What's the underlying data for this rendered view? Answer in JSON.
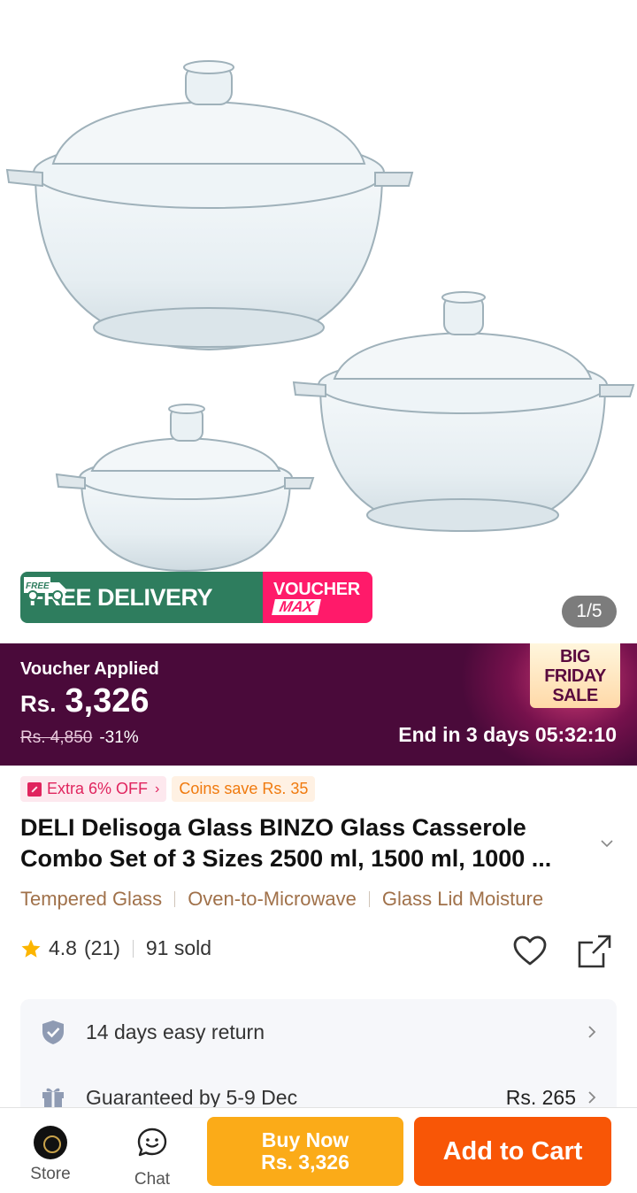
{
  "gallery": {
    "counter": "1/5",
    "promo": {
      "free_icon_text": "FREE",
      "free_delivery": "FREE DELIVERY",
      "voucher_line1": "VOUCHER",
      "voucher_line2": "MAX"
    }
  },
  "price_banner": {
    "voucher_applied": "Voucher Applied",
    "currency": "Rs.",
    "amount": "3,326",
    "original_price": "Rs. 4,850",
    "discount": "-31%",
    "sale_badge_line1": "BIG FRIDAY",
    "sale_badge_line2": "SALE",
    "countdown": "End in 3 days 05:32:10"
  },
  "tags": {
    "extra_off": "Extra 6% OFF",
    "coins": "Coins save Rs. 35"
  },
  "product": {
    "title": "DELI Delisoga Glass BINZO Glass Casserole Combo Set of 3 Sizes 2500 ml, 1500 ml, 1000 ...",
    "features": [
      "Tempered Glass",
      "Oven-to-Microwave",
      "Glass Lid Moisture"
    ],
    "rating": "4.8",
    "reviews": "(21)",
    "sold": "91 sold"
  },
  "service": {
    "return_text": "14 days easy return",
    "delivery_text": "Guaranteed by 5-9 Dec",
    "delivery_fee": "Rs. 265"
  },
  "bottom_bar": {
    "store_label": "Store",
    "chat_label": "Chat",
    "buy_now_line1": "Buy Now",
    "buy_now_line2": "Rs. 3,326",
    "add_to_cart": "Add to Cart"
  },
  "colors": {
    "accent_orange": "#f85606",
    "buy_now_yellow": "#fbab18",
    "banner_purple": "#4a0a3a",
    "free_delivery_green": "#2e7d5e",
    "voucher_pink": "#ff1a6a",
    "feature_brown": "#a0714a"
  }
}
